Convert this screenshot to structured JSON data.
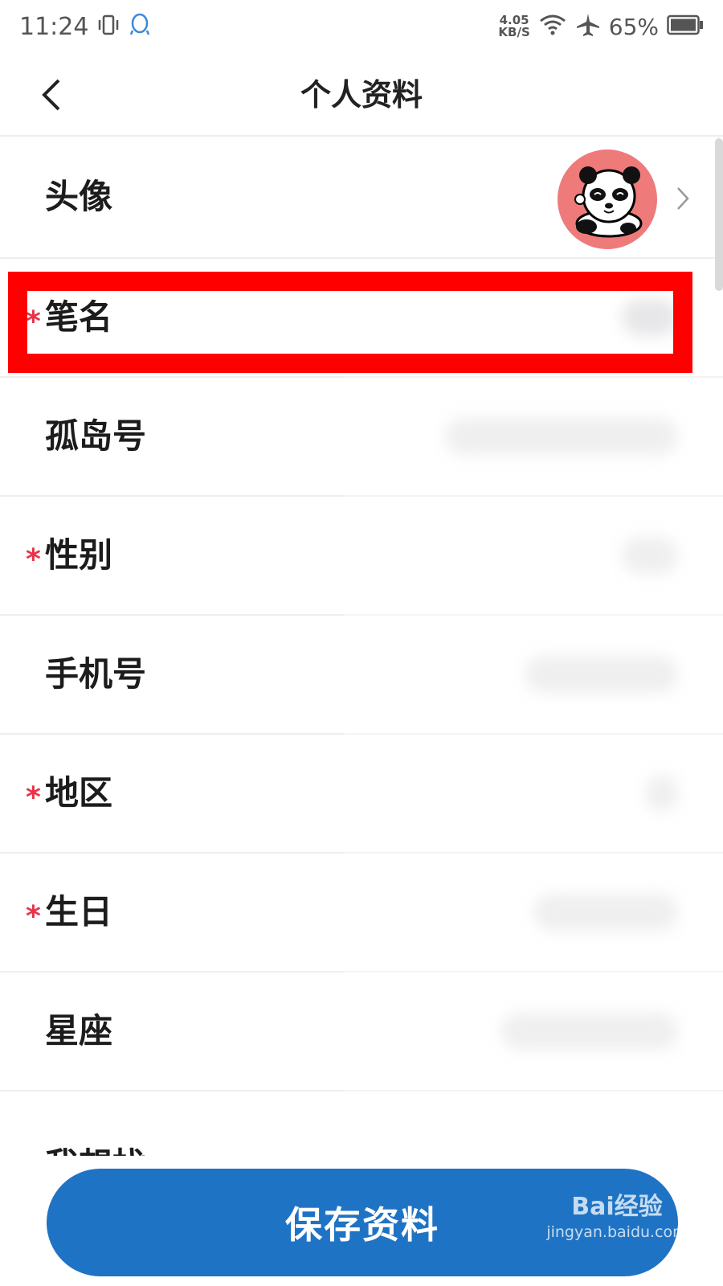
{
  "status_bar": {
    "time": "11:24",
    "net_speed_value": "4.05",
    "net_speed_unit": "KB/S",
    "battery_percent": "65%",
    "icons": [
      "vibrate-icon",
      "qq-icon",
      "wifi-icon",
      "airplane-icon",
      "battery-icon"
    ]
  },
  "nav": {
    "title": "个人资料",
    "back_icon": "chevron-left-icon"
  },
  "rows": [
    {
      "label": "头像",
      "required": false
    },
    {
      "label": "笔名",
      "required": true
    },
    {
      "label": "孤岛号",
      "required": false
    },
    {
      "label": "性别",
      "required": true
    },
    {
      "label": "手机号",
      "required": false
    },
    {
      "label": "地区",
      "required": true
    },
    {
      "label": "生日",
      "required": true
    },
    {
      "label": "星座",
      "required": false
    }
  ],
  "partial_row_label": "我想找",
  "required_marker": "*",
  "save_button": {
    "label": "保存资料"
  },
  "watermark": {
    "logo": "Bai经验",
    "sub": "jingyan.baidu.com"
  },
  "colors": {
    "accent": "#1f73c4",
    "required": "#e8334a",
    "highlight": "#ff0000",
    "avatar_bg": "#ee7a7a"
  }
}
